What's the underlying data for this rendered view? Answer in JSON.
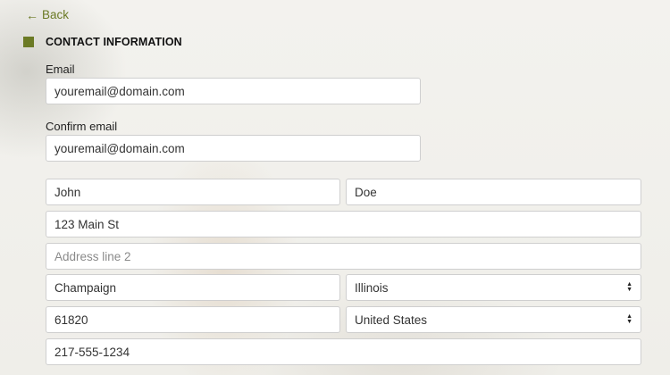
{
  "nav": {
    "back_label": "Back",
    "back_icon": "arrow-left-icon"
  },
  "section": {
    "title": "CONTACT INFORMATION",
    "accent_color": "#6b7a25"
  },
  "form": {
    "email_label": "Email",
    "email_value": "youremail@domain.com",
    "confirm_email_label": "Confirm email",
    "confirm_email_value": "youremail@domain.com",
    "first_name_value": "John",
    "last_name_value": "Doe",
    "address1_value": "123 Main St",
    "address2_placeholder": "Address line 2",
    "city_value": "Champaign",
    "state_value": "Illinois",
    "zip_value": "61820",
    "country_value": "United States",
    "phone_value": "217-555-1234"
  }
}
